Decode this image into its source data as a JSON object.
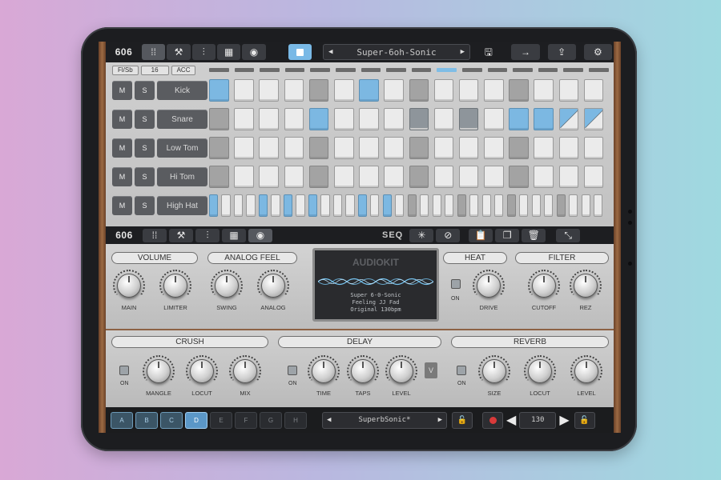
{
  "app": {
    "title": "606",
    "preset": "Super-6oh-Sonic"
  },
  "toolbar": {
    "buttons": [
      "grid-icon",
      "wrench-icon",
      "sliders-icon",
      "pads-icon",
      "record-disc-icon"
    ],
    "stop_icon": "stop-icon",
    "save_icon": "save-icon",
    "next_icon": "arrow-right-icon",
    "share_icon": "share-icon",
    "settings_icon": "gear-icon"
  },
  "sequencer": {
    "header_buttons": [
      "Fl/Sb",
      "16",
      "ACC"
    ],
    "active_step": 10,
    "tracks": [
      {
        "mute": "M",
        "solo": "S",
        "name": "Kick",
        "steps": [
          "b",
          "w",
          "w",
          "w",
          "g",
          "w",
          "b",
          "w",
          "g",
          "w",
          "w",
          "w",
          "g",
          "w",
          "w",
          "w"
        ]
      },
      {
        "mute": "M",
        "solo": "S",
        "name": "Snare",
        "steps": [
          "g",
          "w",
          "w",
          "w",
          "b",
          "w",
          "w",
          "w",
          "d",
          "w",
          "d",
          "w",
          "b",
          "b",
          "h",
          "h"
        ]
      },
      {
        "mute": "M",
        "solo": "S",
        "name": "Low Tom",
        "steps": [
          "g",
          "w",
          "w",
          "w",
          "g",
          "w",
          "w",
          "w",
          "g",
          "w",
          "w",
          "w",
          "g",
          "w",
          "w",
          "w"
        ]
      },
      {
        "mute": "M",
        "solo": "S",
        "name": "Hi Tom",
        "steps": [
          "g",
          "w",
          "w",
          "w",
          "g",
          "w",
          "w",
          "w",
          "g",
          "w",
          "w",
          "w",
          "g",
          "w",
          "w",
          "w"
        ]
      },
      {
        "mute": "M",
        "solo": "S",
        "name": "High Hat",
        "steps": [
          "b",
          "w",
          "w",
          "w",
          "b",
          "w",
          "b",
          "w",
          "b",
          "w",
          "w",
          "w",
          "b",
          "w",
          "b",
          "w",
          "g",
          "w",
          "w",
          "w",
          "g",
          "w",
          "w",
          "w",
          "g",
          "w",
          "w",
          "w",
          "g",
          "w",
          "w",
          "w"
        ]
      }
    ]
  },
  "toolbar2": {
    "title": "606",
    "seq_label": "SEQ"
  },
  "synth": {
    "sections": {
      "volume": "VOLUME",
      "analog_feel": "ANALOG FEEL",
      "heat": "HEAT",
      "filter": "FILTER",
      "crush": "CRUSH",
      "delay": "DELAY",
      "reverb": "REVERB"
    },
    "knobs": {
      "main": "MAIN",
      "limiter": "LIMITER",
      "swing": "SWING",
      "analog": "ANALOG",
      "drive": "DRIVE",
      "cutoff": "CUTOFF",
      "rez": "REZ",
      "mangle": "MANGLE",
      "crush_locut": "LOCUT",
      "mix": "MIX",
      "time": "TIME",
      "taps": "TAPS",
      "level": "LEVEL",
      "size": "SIZE",
      "reverb_locut": "LOCUT",
      "reverb_level": "LEVEL"
    },
    "on_label": "ON",
    "v_button": "V",
    "display": {
      "logo": "AUDIOKIT",
      "line1": "Super 6-0-Sonic",
      "line2": "Feeling JJ Fad",
      "line3": "Original 130bpm"
    }
  },
  "bottom": {
    "banks": [
      "A",
      "B",
      "C",
      "D",
      "E",
      "F",
      "G",
      "H"
    ],
    "selected_bank": "D",
    "kit": "SuperbSonic*",
    "tempo": "130"
  }
}
